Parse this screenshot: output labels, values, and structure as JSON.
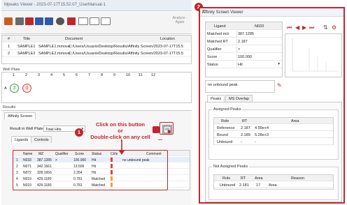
{
  "left_window": {
    "title": "Mpeaks Viewer - 2023-07-17T15.52.07_UserManual-1",
    "toolbar": {
      "analyze_label": "Analyze - Again"
    },
    "datasets": {
      "headers": [
        "#",
        "Title",
        "Document",
        "Location"
      ],
      "rows": [
        [
          "1",
          "SAMPLE1",
          "SAMPLE1.mmova",
          "C:/Users/Usuario/Desktop/Results/Affinity Screen/2023-07-17T15.5"
        ],
        [
          "2",
          "SAMPLE2",
          "SAMPLE2.mmova",
          "C:/Users/Usuario/Desktop/Results/Affinity Screen/2023-07-17T15.5"
        ]
      ]
    },
    "well_plate": {
      "label": "Well Plate",
      "columns": [
        "1",
        "2",
        "3",
        "4",
        "5",
        "6",
        "7",
        "8",
        "9",
        "10",
        "11",
        "12"
      ],
      "row_label": "A",
      "wells": [
        {
          "value": "3",
          "color": "#2e9e3a"
        },
        {
          "value": "0",
          "color": "#e0413a"
        }
      ]
    },
    "results": {
      "label": "Results",
      "tab": "Affinity Screen",
      "filter_label": "Result in Well Plate:",
      "filter_value": "Total Hits",
      "subtabs": [
        "Ligands",
        "Controls"
      ],
      "ligand_headers": [
        "Name",
        "MZ",
        "Qualifier",
        "Score",
        "Status",
        "Ctrls",
        "Comment"
      ],
      "ligand_rows": [
        {
          "n": "1",
          "name": "N033",
          "mz": "387.1285",
          "qual": ">",
          "score": "100.000",
          "status": "Hit",
          "comment": "no unbound peak"
        },
        {
          "n": "2",
          "name": "N071",
          "mz": "342.1561",
          "qual": "",
          "score": "13.506",
          "status": "Hit",
          "comment": ""
        },
        {
          "n": "3",
          "name": "N072",
          "mz": "328.1656",
          "qual": "",
          "score": "2.354",
          "status": "Hit",
          "comment": ""
        },
        {
          "n": "4",
          "name": "N019",
          "mz": "429.1180",
          "qual": "",
          "score": "0.781",
          "status": "Matched",
          "comment": ""
        },
        {
          "n": "5",
          "name": "N019",
          "mz": "429.1180",
          "qual": "",
          "score": "0.781",
          "status": "Matched",
          "comment": ""
        }
      ]
    }
  },
  "annotations": {
    "badge1": "1",
    "badge2": "2",
    "callout_line1": "Click on this button",
    "callout_line2": "or",
    "callout_line3": "Double-click on any cell"
  },
  "right_window": {
    "title": "Affinity Screen Viewer",
    "ligand": {
      "header_key": "Ligand",
      "header_value": "N033",
      "rows": [
        {
          "key": "Matched m/z",
          "value": "387.1285"
        },
        {
          "key": "Matched RT",
          "value": "2.187"
        },
        {
          "key": "Qualifier",
          "value": ">"
        },
        {
          "key": "Score",
          "value": "100.000"
        },
        {
          "key": "Status",
          "value": "Hit"
        }
      ]
    },
    "note": "no unbound peak",
    "tabs": [
      "Peaks",
      "MS Overlap"
    ],
    "assigned": {
      "title": "Assigned Peaks",
      "headers": [
        "Role",
        "RT",
        "Area"
      ],
      "rows": [
        [
          "Reference",
          "2.187",
          "4.99e+4"
        ],
        [
          "Bound",
          "2.189",
          "5.28e+3"
        ],
        [
          "Unbound",
          "-",
          "-"
        ]
      ]
    },
    "not_assigned": {
      "title": "Not Assigned Peaks",
      "headers": [
        "Role",
        "RT",
        "Area",
        "Reason"
      ],
      "rows": [
        [
          "Unbound",
          "2.181",
          "17",
          "Area"
        ]
      ]
    }
  },
  "colors": {
    "accent_red": "#c0262e",
    "hit_green": "#2e9e3a",
    "miss_red": "#e0413a"
  }
}
